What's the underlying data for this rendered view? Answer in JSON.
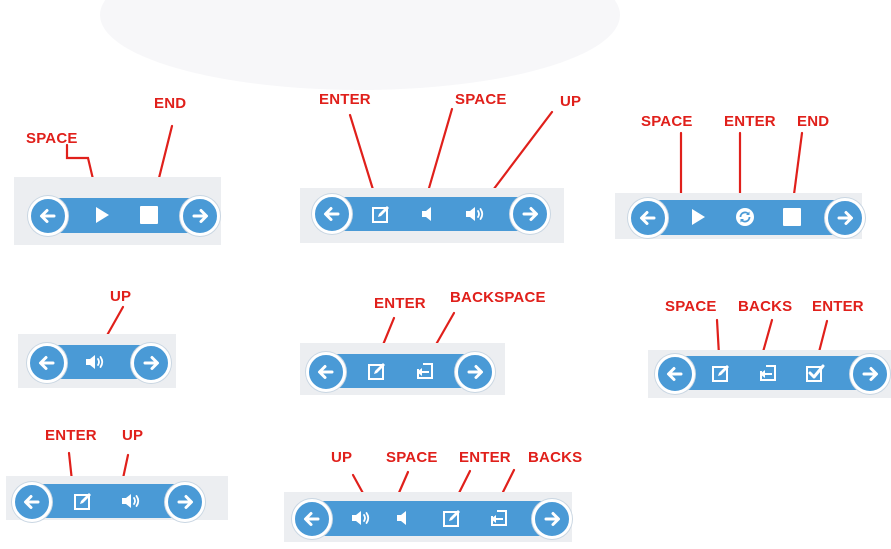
{
  "annotations": {
    "space": "SPACE",
    "end": "END",
    "enter": "ENTER",
    "up": "UP",
    "backspace": "BACKSPACE",
    "backs": "BACKS"
  },
  "colors": {
    "bar": "#4a9ad6",
    "annotation": "#e0201b",
    "panel": "#eceef1"
  },
  "icons": [
    "arrow-left-icon",
    "arrow-right-icon",
    "play-icon",
    "stop-icon",
    "edit-icon",
    "volume-low-icon",
    "volume-high-icon",
    "replay-icon",
    "back-icon",
    "check-icon"
  ]
}
